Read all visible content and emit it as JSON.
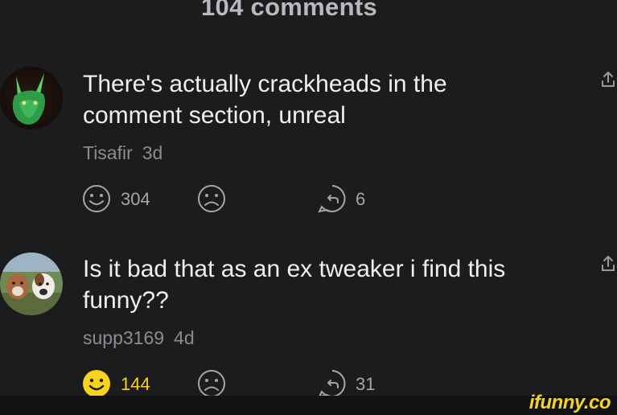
{
  "header": {
    "title": "104 comments"
  },
  "comments": [
    {
      "text": "There's actually crackheads in the comment section, unreal",
      "author": "Tisafir",
      "age": "3d",
      "smile_count": "304",
      "reply_count": "6",
      "liked": false,
      "avatar": "green-dragon-avatar"
    },
    {
      "text": "Is it bad that as an ex tweaker i find this funny??",
      "author": "supp3169",
      "age": "4d",
      "smile_count": "144",
      "reply_count": "31",
      "liked": true,
      "avatar": "two-dogs-avatar"
    }
  ],
  "watermark": {
    "text": "ifunny.co"
  },
  "colors": {
    "background": "#1c1c1e",
    "text": "#efefef",
    "muted": "#8c8c90",
    "accent": "#f7d31c"
  }
}
